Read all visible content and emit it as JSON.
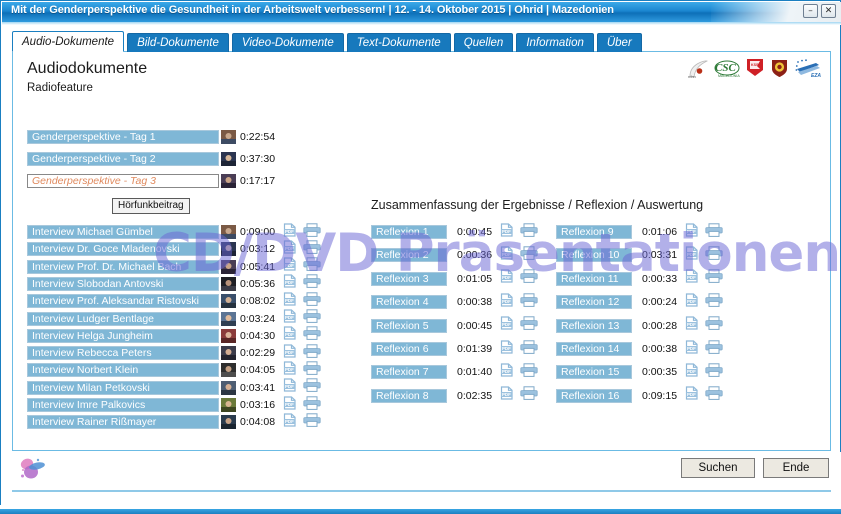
{
  "window": {
    "title": "Mit der Genderperspektive die Gesundheit in der Arbeitswelt verbessern! | 12. - 14. Oktober 2015 | Ohrid | Mazedonien",
    "minimize_label": "–",
    "close_label": "✕",
    "accent_color": "#1a86d0",
    "pill_color": "#7fb7d6",
    "hover_text_color": "#e08a5e",
    "watermark": "CD/DVD Präsentationen"
  },
  "tabs": [
    {
      "label": "Audio-Dokumente",
      "active": true
    },
    {
      "label": "Bild-Dokumente",
      "active": false
    },
    {
      "label": "Video-Dokumente",
      "active": false
    },
    {
      "label": "Text-Dokumente",
      "active": false
    },
    {
      "label": "Quellen",
      "active": false
    },
    {
      "label": "Information",
      "active": false
    },
    {
      "label": "Über",
      "active": false
    }
  ],
  "main": {
    "heading": "Audiodokumente",
    "subheading": "Radiofeature",
    "tooltip": "Hörfunkbeitrag",
    "reflexion_section_title": "Zusammenfassung der Ergebnisse / Reflexion / Auswertung"
  },
  "radiofeature": [
    {
      "label": "Genderperspektive - Tag 1",
      "time": "0:22:54",
      "hover": false
    },
    {
      "label": "Genderperspektive - Tag 2",
      "time": "0:37:30",
      "hover": false
    },
    {
      "label": "Genderperspektive - Tag 3",
      "time": "0:17:17",
      "hover": true
    }
  ],
  "interviews": [
    {
      "label": "Interview Michael Gümbel",
      "time": "0:09:00"
    },
    {
      "label": "Interview Dr. Goce Mladenovski",
      "time": "0:03:12"
    },
    {
      "label": "Interview Prof. Dr. Michael Bach",
      "time": "0:05:41"
    },
    {
      "label": "Interview Slobodan Antovski",
      "time": "0:05:36"
    },
    {
      "label": "Interview Prof. Aleksandar Ristovski",
      "time": "0:08:02"
    },
    {
      "label": "Interview Ludger Bentlage",
      "time": "0:03:24"
    },
    {
      "label": "Interview Helga Jungheim",
      "time": "0:04:30"
    },
    {
      "label": "Interview Rebecca Peters",
      "time": "0:02:29"
    },
    {
      "label": "Interview Norbert Klein",
      "time": "0:04:05"
    },
    {
      "label": "Interview Milan Petkovski",
      "time": "0:03:41"
    },
    {
      "label": "Interview Imre Palkovics",
      "time": "0:03:16"
    },
    {
      "label": "Interview Rainer Rißmayer",
      "time": "0:04:08"
    }
  ],
  "reflexion_left": [
    {
      "label": "Reflexion 1",
      "time": "0:00:45"
    },
    {
      "label": "Reflexion 2",
      "time": "0:00:36"
    },
    {
      "label": "Reflexion 3",
      "time": "0:01:05"
    },
    {
      "label": "Reflexion 4",
      "time": "0:00:38"
    },
    {
      "label": "Reflexion 5",
      "time": "0:00:45"
    },
    {
      "label": "Reflexion 6",
      "time": "0:01:39"
    },
    {
      "label": "Reflexion 7",
      "time": "0:01:40"
    },
    {
      "label": "Reflexion 8",
      "time": "0:02:35"
    }
  ],
  "reflexion_right": [
    {
      "label": "Reflexion 9",
      "time": "0:01:06"
    },
    {
      "label": "Reflexion 10",
      "time": "0:03:31"
    },
    {
      "label": "Reflexion 11",
      "time": "0:00:33"
    },
    {
      "label": "Reflexion 12",
      "time": "0:00:24"
    },
    {
      "label": "Reflexion 13",
      "time": "0:00:28"
    },
    {
      "label": "Reflexion 14",
      "time": "0:00:38"
    },
    {
      "label": "Reflexion 15",
      "time": "0:00:35"
    },
    {
      "label": "Reflexion 16",
      "time": "0:09:15"
    }
  ],
  "logos": [
    {
      "name": "mbn-logo"
    },
    {
      "name": "csc-logo"
    },
    {
      "name": "red-flag-logo"
    },
    {
      "name": "shield-logo"
    },
    {
      "name": "eza-logo"
    }
  ],
  "footer": {
    "search_label": "Suchen",
    "end_label": "Ende",
    "brand_icon": "butterfly-icon"
  }
}
